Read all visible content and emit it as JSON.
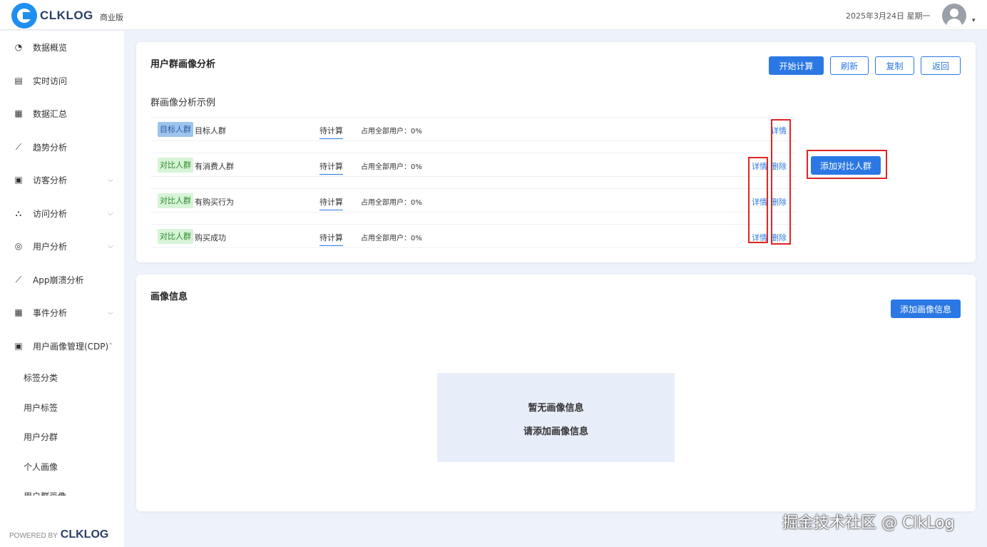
{
  "header": {
    "brand": "CLKLOG",
    "edition": "商业版",
    "date": "2025年3月24日 星期一",
    "caret": "▾"
  },
  "sidebar": {
    "items": [
      {
        "label": "数据概览",
        "icon": "dashboard-icon",
        "glyph": "◔",
        "chevron": ""
      },
      {
        "label": "实时访问",
        "icon": "realtime-icon",
        "glyph": "▤",
        "chevron": ""
      },
      {
        "label": "数据汇总",
        "icon": "summary-icon",
        "glyph": "▦",
        "chevron": ""
      },
      {
        "label": "趋势分析",
        "icon": "trend-chart-icon",
        "glyph": "⟋",
        "chevron": ""
      },
      {
        "label": "访客分析",
        "icon": "visitor-icon",
        "glyph": "▣",
        "chevron": "⌵"
      },
      {
        "label": "访问分析",
        "icon": "hierarchy-icon",
        "glyph": "⛬",
        "chevron": "⌵"
      },
      {
        "label": "用户分析",
        "icon": "user-icon",
        "glyph": "◎",
        "chevron": "⌵"
      },
      {
        "label": "App崩溃分析",
        "icon": "crash-chart-icon",
        "glyph": "⟋",
        "chevron": ""
      },
      {
        "label": "事件分析",
        "icon": "event-icon",
        "glyph": "▦",
        "chevron": "⌵"
      },
      {
        "label": "用户画像管理(CDP)",
        "icon": "cdp-icon",
        "glyph": "▣",
        "chevron": "⌃"
      }
    ],
    "subitems": [
      "标签分类",
      "用户标签",
      "用户分群",
      "个人画像",
      "用户群画像"
    ],
    "powered_label": "POWERED BY",
    "powered_brand": "CLKLOG"
  },
  "group_card": {
    "title": "用户群画像分析",
    "buttons": {
      "start": "开始计算",
      "refresh": "刷新",
      "copy": "复制",
      "back": "返回"
    },
    "subtitle": "群画像分析示例",
    "rows": [
      {
        "tag": "目标人群",
        "name": "目标人群",
        "status": "待计算",
        "ratio": "占用全部用户：0%",
        "detail": "详情",
        "delete": ""
      },
      {
        "tag": "对比人群",
        "name": "有消费人群",
        "status": "待计算",
        "ratio": "占用全部用户：0%",
        "detail": "详情",
        "delete": "删除"
      },
      {
        "tag": "对比人群",
        "name": "有购买行为",
        "status": "待计算",
        "ratio": "占用全部用户：0%",
        "detail": "详情",
        "delete": "删除"
      },
      {
        "tag": "对比人群",
        "name": "购买成功",
        "status": "待计算",
        "ratio": "占用全部用户：0%",
        "detail": "详情",
        "delete": "删除"
      }
    ],
    "add_compare": "添加对比人群"
  },
  "profile_card": {
    "title": "画像信息",
    "add_button": "添加画像信息",
    "empty_line1": "暂无画像信息",
    "empty_line2": "请添加画像信息"
  },
  "watermark": "掘金技术社区 @ ClkLog",
  "colors": {
    "primary": "#2b78e4",
    "highlight_box": "#e02424",
    "target_tag_bg": "#9ec3ee",
    "compare_tag_bg": "#d7f4d7"
  }
}
